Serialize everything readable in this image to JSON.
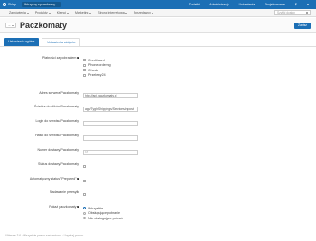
{
  "topbar": {
    "home_label": "Sklep",
    "vendor_selector": "Wszyscy sprzedawcy",
    "right_items": [
      "Dodatki",
      "Administracja",
      "Ustawienia",
      "Projektowanie",
      "$",
      ""
    ]
  },
  "menu": {
    "items": [
      "Zamówienia",
      "Produkty",
      "Klienci",
      "Marketing",
      "Strona internetowa",
      "Sprzedawcy"
    ],
    "search_placeholder": "Szybki dostęp"
  },
  "header": {
    "title": "Paczkomaty",
    "save_label": "Zapisz"
  },
  "tabs": [
    "Ustawienia ogólne",
    "Ustawienia widgetu"
  ],
  "form": {
    "payments_label": "Płatności za pobraniem",
    "payment_options": [
      "Credit card",
      "Phone ordering",
      "Check",
      "Przelewy24"
    ],
    "api_url_label": "Adres serwera Paczkomaty:",
    "api_url_value": "http://api.paczkomaty.pl",
    "path_label": "Ścieżka do plików Paczkomaty:",
    "path_value": "app/Tygh/Shippings/Services/Inpost",
    "login_label": "Login do serwisu Paczkomaty:",
    "login_value": "",
    "password_label": "Hasło do serwisu Paczkomaty:",
    "password_value": "",
    "number_label": "Numer dostawy Paczkomaty:",
    "number_value": "13",
    "status_label": "Status dostawy Paczkomaty:",
    "auto_label": "Automatyczny status \"Prepared\"",
    "parcel_label": "Nadawanie przesyłki",
    "show_label": "Pokaż paczkomaty",
    "show_options": [
      "Wszystkie",
      "Obsługujące pobranie",
      "Nie obsługujące pobrań"
    ]
  },
  "footer": {
    "text": "Ultimate 3.6 · Wszystkie prawa zastrzeżone · Uzyskaj pomoc"
  }
}
